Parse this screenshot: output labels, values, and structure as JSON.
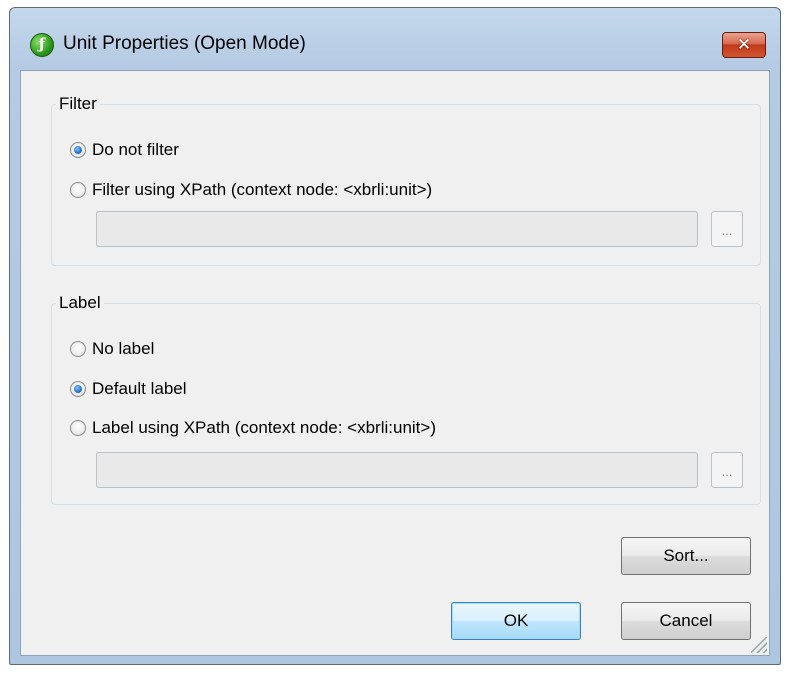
{
  "window": {
    "title": "Unit Properties (Open Mode)",
    "close_label": "✕"
  },
  "filter": {
    "group_title": "Filter",
    "options": [
      {
        "label": "Do not filter",
        "checked": true
      },
      {
        "label": "Filter using XPath (context node: <xbrli:unit>)",
        "checked": false
      }
    ],
    "xpath_value": "",
    "browse_label": "..."
  },
  "label": {
    "group_title": "Label",
    "options": [
      {
        "label": "No label",
        "checked": false
      },
      {
        "label": "Default label",
        "checked": true
      },
      {
        "label": "Label using XPath (context node: <xbrli:unit>)",
        "checked": false
      }
    ],
    "xpath_value": "",
    "browse_label": "..."
  },
  "buttons": {
    "sort": "Sort...",
    "ok": "OK",
    "cancel": "Cancel"
  }
}
